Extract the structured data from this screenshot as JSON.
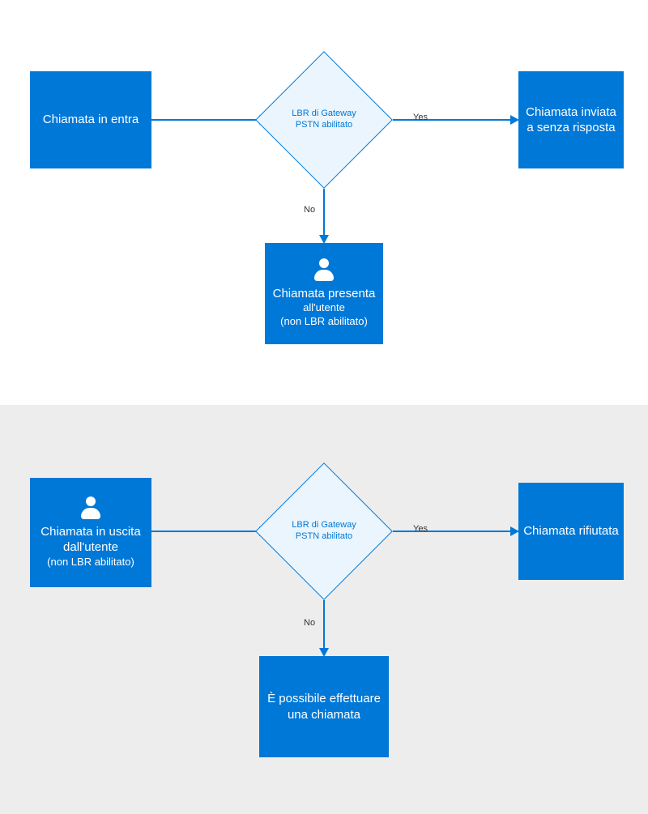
{
  "colors": {
    "primary": "#0078d7",
    "diamondFill": "#eaf5fd",
    "sectionBottomBg": "#ededed"
  },
  "top": {
    "start": {
      "text": "Chiamata in entra"
    },
    "decision": {
      "line1": "LBR di Gateway",
      "line2": "PSTN abilitato"
    },
    "yesLabel": "Yes",
    "noLabel": "No",
    "yesResult": {
      "line1": "Chiamata inviata",
      "line2": "a senza risposta"
    },
    "noResult": {
      "line1": "Chiamata presenta",
      "line2": "all'utente",
      "line3": "(non LBR abilitato)",
      "hasUserIcon": true
    }
  },
  "bottom": {
    "start": {
      "line1": "Chiamata in uscita",
      "line2": "dall'utente",
      "line3": "(non LBR abilitato)",
      "hasUserIcon": true
    },
    "decision": {
      "line1": "LBR di Gateway",
      "line2": "PSTN abilitato"
    },
    "yesLabel": "Yes",
    "noLabel": "No",
    "yesResult": {
      "text": "Chiamata rifiutata"
    },
    "noResult": {
      "line1": "È possibile effettuare",
      "line2": "una chiamata"
    }
  }
}
